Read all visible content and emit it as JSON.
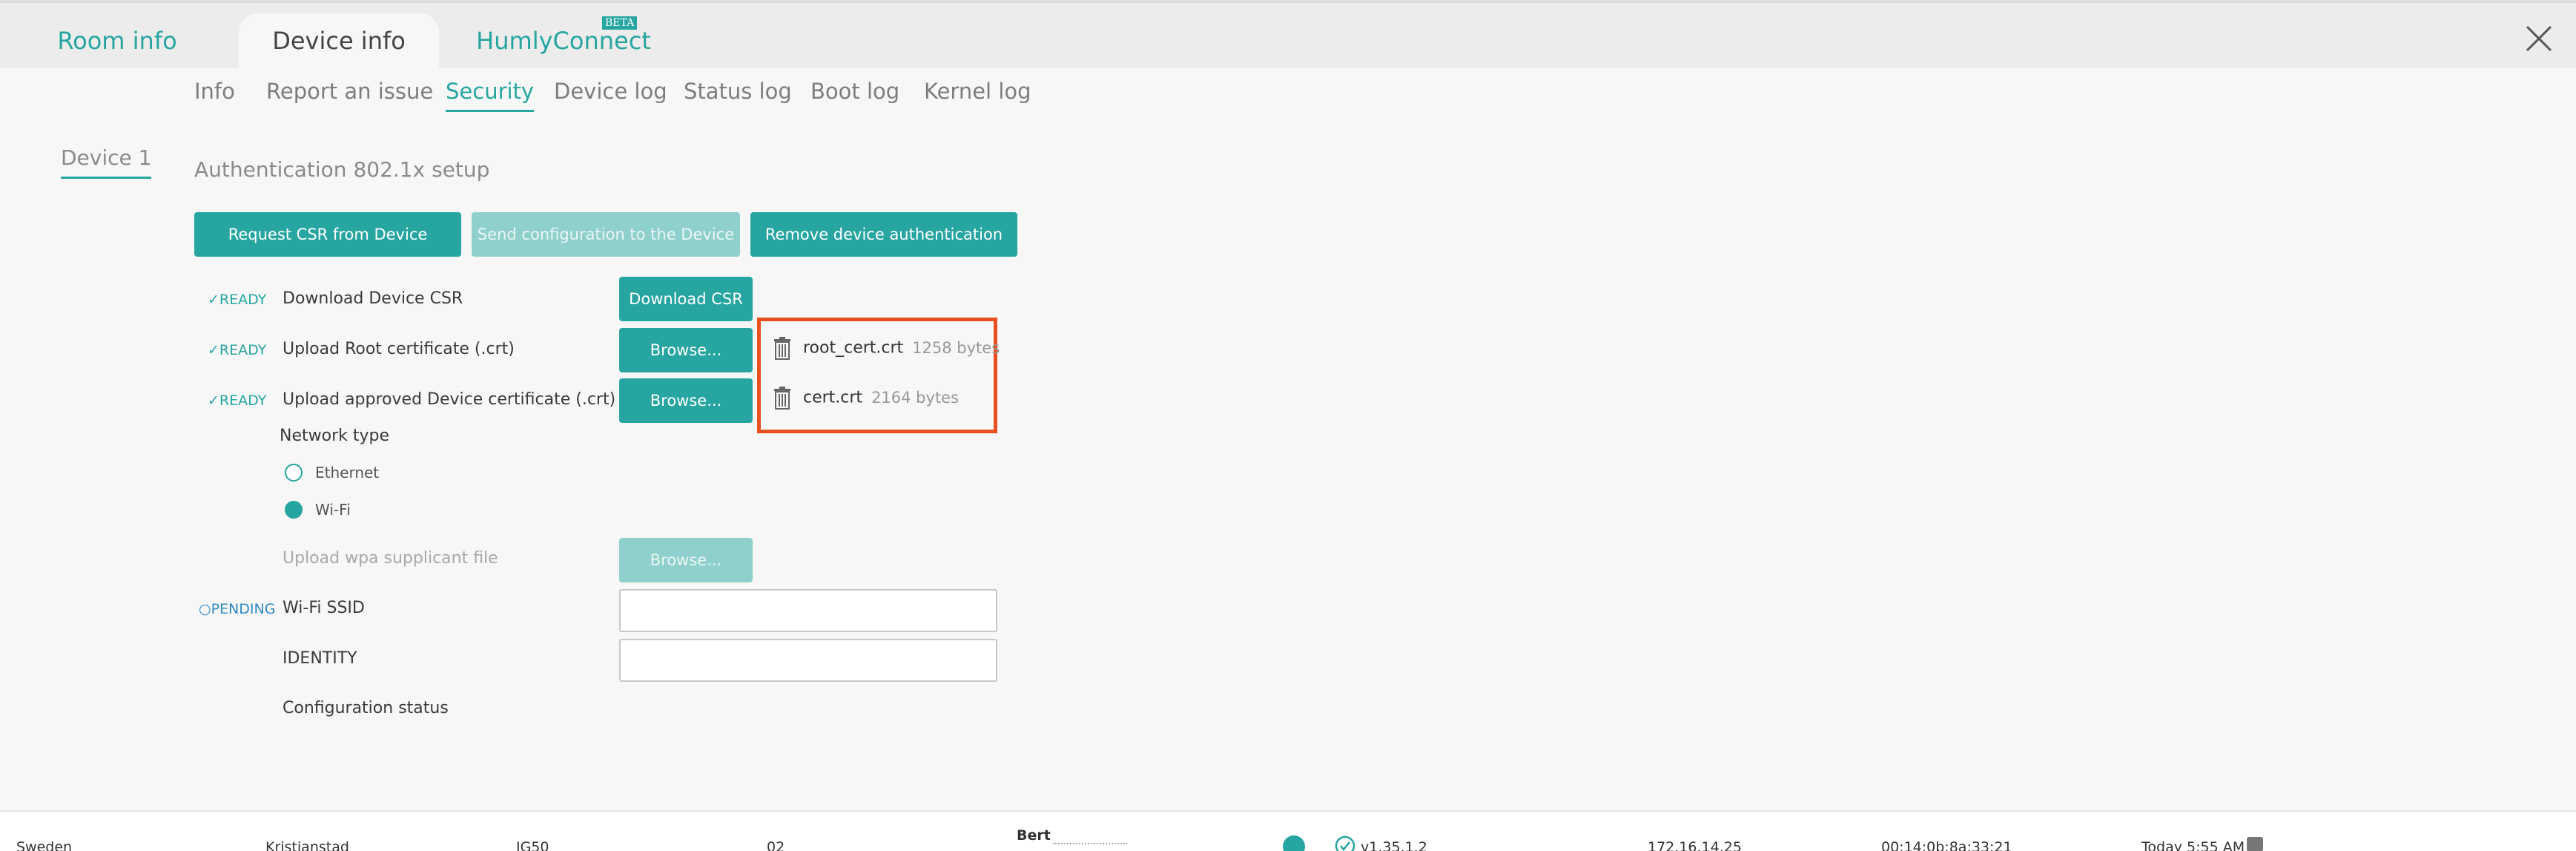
{
  "window_tabs": {
    "room_info": "Room info",
    "device_info": "Device info",
    "humly_connect": "HumlyConnect",
    "beta_badge": "BETA"
  },
  "subnav": [
    "Info",
    "Report an issue",
    "Security",
    "Device log",
    "Status log",
    "Boot log",
    "Kernel log"
  ],
  "device_tab": "Device 1",
  "section_title": "Authentication 802.1x setup",
  "actions": {
    "request_csr": "Request CSR from Device",
    "send_config": "Send configuration to the Device",
    "remove_auth": "Remove device authentication"
  },
  "rows": [
    {
      "status": "✓READY",
      "label": "Download Device CSR",
      "button": "Download CSR"
    },
    {
      "status": "✓READY",
      "label": "Upload Root certificate (.crt)",
      "button": "Browse..."
    },
    {
      "status": "✓READY",
      "label": "Upload approved Device certificate (.crt)",
      "button": "Browse..."
    }
  ],
  "files": [
    {
      "name": "root_cert.crt",
      "size": "1258 bytes"
    },
    {
      "name": "cert.crt",
      "size": "2164 bytes"
    }
  ],
  "network": {
    "label": "Network type",
    "options": [
      "Ethernet",
      "Wi-Fi"
    ],
    "selected": "Wi-Fi"
  },
  "wpa": {
    "label": "Upload wpa supplicant file",
    "button": "Browse..."
  },
  "ssid": {
    "status": "○PENDING",
    "label": "Wi-Fi SSID",
    "value": ""
  },
  "identity": {
    "label": "IDENTITY",
    "value": ""
  },
  "config_status": {
    "label": "Configuration status"
  },
  "bottom_row": {
    "country": "Sweden",
    "city": "Kristianstad",
    "model": "IG50",
    "floor": "02",
    "name": "Bert",
    "version": "v1.35.1.2",
    "ip": "172.16.14.25",
    "mac": "00:14:0b:8a:33:21",
    "last_seen": "Today 5:55 AM"
  },
  "colors": {
    "accent": "#26a5a1",
    "highlight": "#e8501f",
    "pending": "#2f88c4"
  }
}
